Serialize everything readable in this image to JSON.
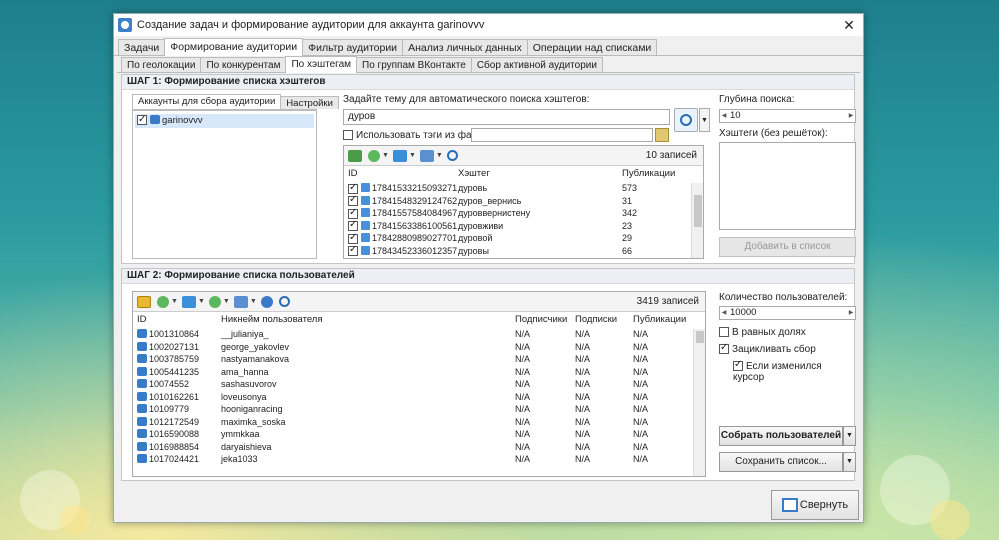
{
  "window": {
    "title": "Создание задач и формирование аудитории для аккаунта garinovvv"
  },
  "main_tabs": [
    "Задачи",
    "Формирование аудитории",
    "Фильтр аудитории",
    "Анализ личных данных",
    "Операции над списками"
  ],
  "sub_tabs": [
    "По геолокации",
    "По конкурентам",
    "По хэштегам",
    "По группам ВКонтакте",
    "Сбор активной аудитории"
  ],
  "step1": {
    "title": "ШАГ 1: Формирование списка хэштегов",
    "acc_tabs": [
      "Аккаунты для сбора аудитории",
      "Настройки"
    ],
    "accounts": [
      {
        "name": "garinovvv",
        "checked": true
      }
    ],
    "topic_label": "Задайте тему для автоматического поиска хэштегов:",
    "topic_value": "дуров",
    "use_file_label": "Использовать тэги из файла:",
    "count": "10 записей",
    "columns": [
      "ID",
      "Хэштег",
      "Публикации"
    ],
    "rows": [
      {
        "id": "17841533215093271",
        "tag": "дуровь",
        "pubs": "573"
      },
      {
        "id": "17841548329124762",
        "tag": "дуров_вернись",
        "pubs": "31"
      },
      {
        "id": "17841557584084967",
        "tag": "дуроввернистену",
        "pubs": "342"
      },
      {
        "id": "17841563386100561",
        "tag": "дуровживи",
        "pubs": "23"
      },
      {
        "id": "17842880989027701",
        "tag": "дуровой",
        "pubs": "29"
      },
      {
        "id": "17843452336012357",
        "tag": "дуровы",
        "pubs": "66"
      }
    ],
    "depth_label": "Глубина поиска:",
    "depth_value": "10",
    "hashtags_label": "Хэштеги (без решёток):",
    "add_button": "Добавить в список"
  },
  "step2": {
    "title": "ШАГ 2: Формирование списка пользователей",
    "count": "3419 записей",
    "columns": [
      "ID",
      "Никнейм пользователя",
      "Подписчики",
      "Подписки",
      "Публикации"
    ],
    "rows": [
      {
        "id": "1001310864",
        "nick": "__julianiya_",
        "a": "N/A",
        "b": "N/A",
        "c": "N/A"
      },
      {
        "id": "1002027131",
        "nick": "george_yakovlev",
        "a": "N/A",
        "b": "N/A",
        "c": "N/A"
      },
      {
        "id": "1003785759",
        "nick": "nastyamanakova",
        "a": "N/A",
        "b": "N/A",
        "c": "N/A"
      },
      {
        "id": "1005441235",
        "nick": "ama_hanna",
        "a": "N/A",
        "b": "N/A",
        "c": "N/A"
      },
      {
        "id": "10074552",
        "nick": "sashasuvorov",
        "a": "N/A",
        "b": "N/A",
        "c": "N/A"
      },
      {
        "id": "1010162261",
        "nick": "loveusonya",
        "a": "N/A",
        "b": "N/A",
        "c": "N/A"
      },
      {
        "id": "10109779",
        "nick": "hooniganracing",
        "a": "N/A",
        "b": "N/A",
        "c": "N/A"
      },
      {
        "id": "1012172549",
        "nick": "maximka_soska",
        "a": "N/A",
        "b": "N/A",
        "c": "N/A"
      },
      {
        "id": "1016590088",
        "nick": "ymmkkaa",
        "a": "N/A",
        "b": "N/A",
        "c": "N/A"
      },
      {
        "id": "1016988854",
        "nick": "daryaishieva",
        "a": "N/A",
        "b": "N/A",
        "c": "N/A"
      },
      {
        "id": "1017024421",
        "nick": "jeka1033",
        "a": "N/A",
        "b": "N/A",
        "c": "N/A"
      }
    ],
    "users_count_label": "Количество пользователей:",
    "users_count_value": "10000",
    "equal_parts": "В равных долях",
    "loop": "Зацикливать сбор",
    "cursor": "Если изменился курсор",
    "collect_button": "Собрать пользователей",
    "save_button": "Сохранить список..."
  },
  "footer": {
    "collapse_button": "Свернуть"
  }
}
